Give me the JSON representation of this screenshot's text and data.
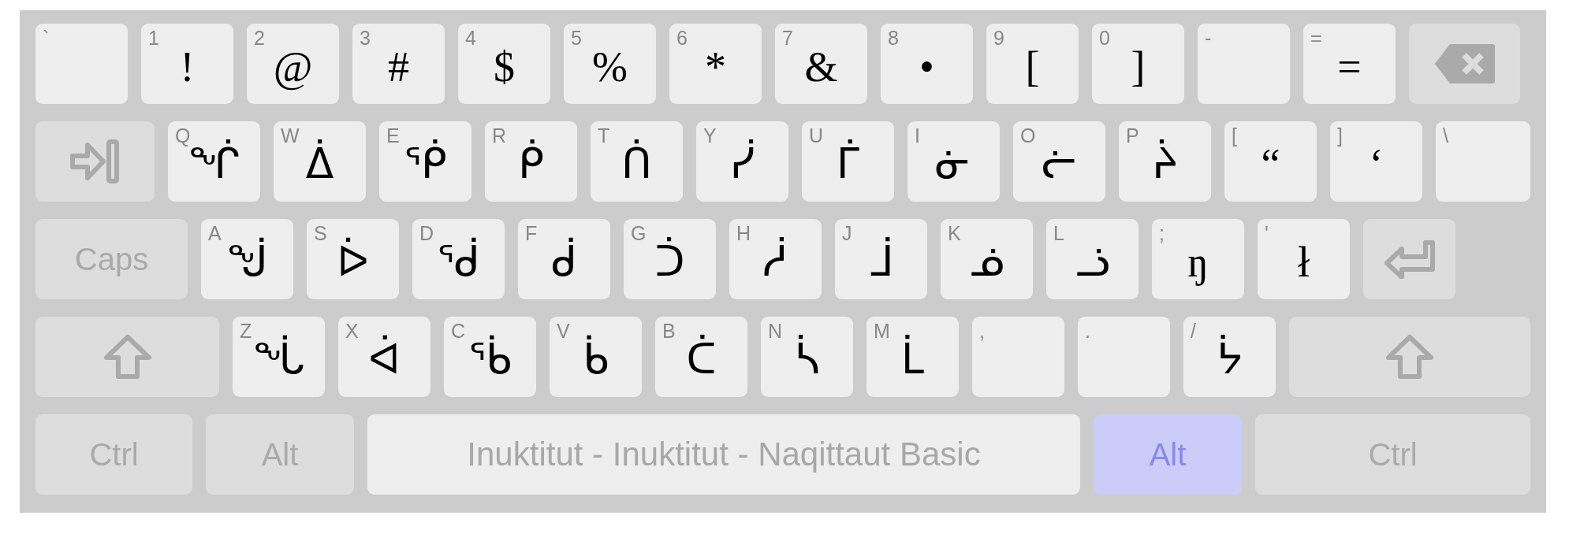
{
  "keyboard": {
    "rows": [
      {
        "keys": [
          {
            "kind": "symbol",
            "legend": "`"
          },
          {
            "kind": "symbol",
            "legend": "1",
            "char": "!"
          },
          {
            "kind": "symbol",
            "legend": "2",
            "char": "@"
          },
          {
            "kind": "symbol",
            "legend": "3",
            "char": "#"
          },
          {
            "kind": "symbol",
            "legend": "4",
            "char": "$"
          },
          {
            "kind": "symbol",
            "legend": "5",
            "char": "%"
          },
          {
            "kind": "symbol",
            "legend": "6",
            "char": "*"
          },
          {
            "kind": "symbol",
            "legend": "7",
            "char": "&"
          },
          {
            "kind": "symbol",
            "legend": "8",
            "char": "•"
          },
          {
            "kind": "symbol",
            "legend": "9",
            "char": "["
          },
          {
            "kind": "symbol",
            "legend": "0",
            "char": "]"
          },
          {
            "kind": "symbol",
            "legend": "-"
          },
          {
            "kind": "symbol",
            "legend": "=",
            "char": "="
          },
          {
            "kind": "backspace"
          }
        ]
      },
      {
        "keys": [
          {
            "kind": "tab"
          },
          {
            "kind": "syllabic",
            "legend": "Q",
            "char": "ᖐ"
          },
          {
            "kind": "syllabic",
            "legend": "W",
            "char": "ᐄ"
          },
          {
            "kind": "syllabic",
            "legend": "E",
            "char": "ᖀ"
          },
          {
            "kind": "syllabic",
            "legend": "R",
            "char": "ᑮ"
          },
          {
            "kind": "syllabic",
            "legend": "T",
            "char": "ᑏ"
          },
          {
            "kind": "syllabic",
            "legend": "Y",
            "char": "ᓰ"
          },
          {
            "kind": "syllabic",
            "legend": "U",
            "char": "ᒦ"
          },
          {
            "kind": "syllabic",
            "legend": "I",
            "char": "ᓃ"
          },
          {
            "kind": "syllabic",
            "legend": "O",
            "char": "ᓖ"
          },
          {
            "kind": "syllabic",
            "legend": "P",
            "char": "ᔩ"
          },
          {
            "kind": "symbol",
            "legend": "[",
            "char": "“"
          },
          {
            "kind": "symbol",
            "legend": "]",
            "char": "‘"
          },
          {
            "kind": "symbol",
            "legend": "\\",
            "wide": true
          }
        ]
      },
      {
        "keys": [
          {
            "kind": "caps",
            "label": "Caps",
            "selected": false
          },
          {
            "kind": "syllabic",
            "legend": "A",
            "char": "ᖒ"
          },
          {
            "kind": "syllabic",
            "legend": "S",
            "char": "ᐆ"
          },
          {
            "kind": "syllabic",
            "legend": "D",
            "char": "ᖂ"
          },
          {
            "kind": "syllabic",
            "legend": "F",
            "char": "ᑰ"
          },
          {
            "kind": "syllabic",
            "legend": "G",
            "char": "ᑑ"
          },
          {
            "kind": "syllabic",
            "legend": "H",
            "char": "ᓲ"
          },
          {
            "kind": "syllabic",
            "legend": "J",
            "char": "ᒨ"
          },
          {
            "kind": "syllabic",
            "legend": "K",
            "char": "ᓅ"
          },
          {
            "kind": "syllabic",
            "legend": "L",
            "char": "ᓘ"
          },
          {
            "kind": "symbol",
            "legend": ";",
            "char": "ŋ"
          },
          {
            "kind": "symbol",
            "legend": "'",
            "char": "ł"
          },
          {
            "kind": "enter"
          }
        ]
      },
      {
        "keys": [
          {
            "kind": "shift",
            "selected": false
          },
          {
            "kind": "syllabic",
            "legend": "Z",
            "char": "ᖔ"
          },
          {
            "kind": "syllabic",
            "legend": "X",
            "char": "ᐋ"
          },
          {
            "kind": "syllabic",
            "legend": "C",
            "char": "ᖄ"
          },
          {
            "kind": "syllabic",
            "legend": "V",
            "char": "ᑳ"
          },
          {
            "kind": "syllabic",
            "legend": "B",
            "char": "ᑖ"
          },
          {
            "kind": "syllabic",
            "legend": "N",
            "char": "ᓵ"
          },
          {
            "kind": "syllabic",
            "legend": "M",
            "char": "ᒫ"
          },
          {
            "kind": "symbol",
            "legend": ","
          },
          {
            "kind": "symbol",
            "legend": "."
          },
          {
            "kind": "syllabic",
            "legend": "/",
            "char": "ᔮ"
          },
          {
            "kind": "shift",
            "selected": false,
            "wide": true
          }
        ]
      },
      {
        "keys": [
          {
            "kind": "ctrl",
            "label": "Ctrl",
            "selected": false
          },
          {
            "kind": "alt",
            "label": "Alt",
            "selected": false
          },
          {
            "kind": "space",
            "label": "Inuktitut - Inuktitut - Naqittaut Basic"
          },
          {
            "kind": "alt",
            "label": "Alt",
            "selected": true
          },
          {
            "kind": "ctrl",
            "label": "Ctrl",
            "selected": false,
            "wide": true
          }
        ]
      }
    ]
  }
}
